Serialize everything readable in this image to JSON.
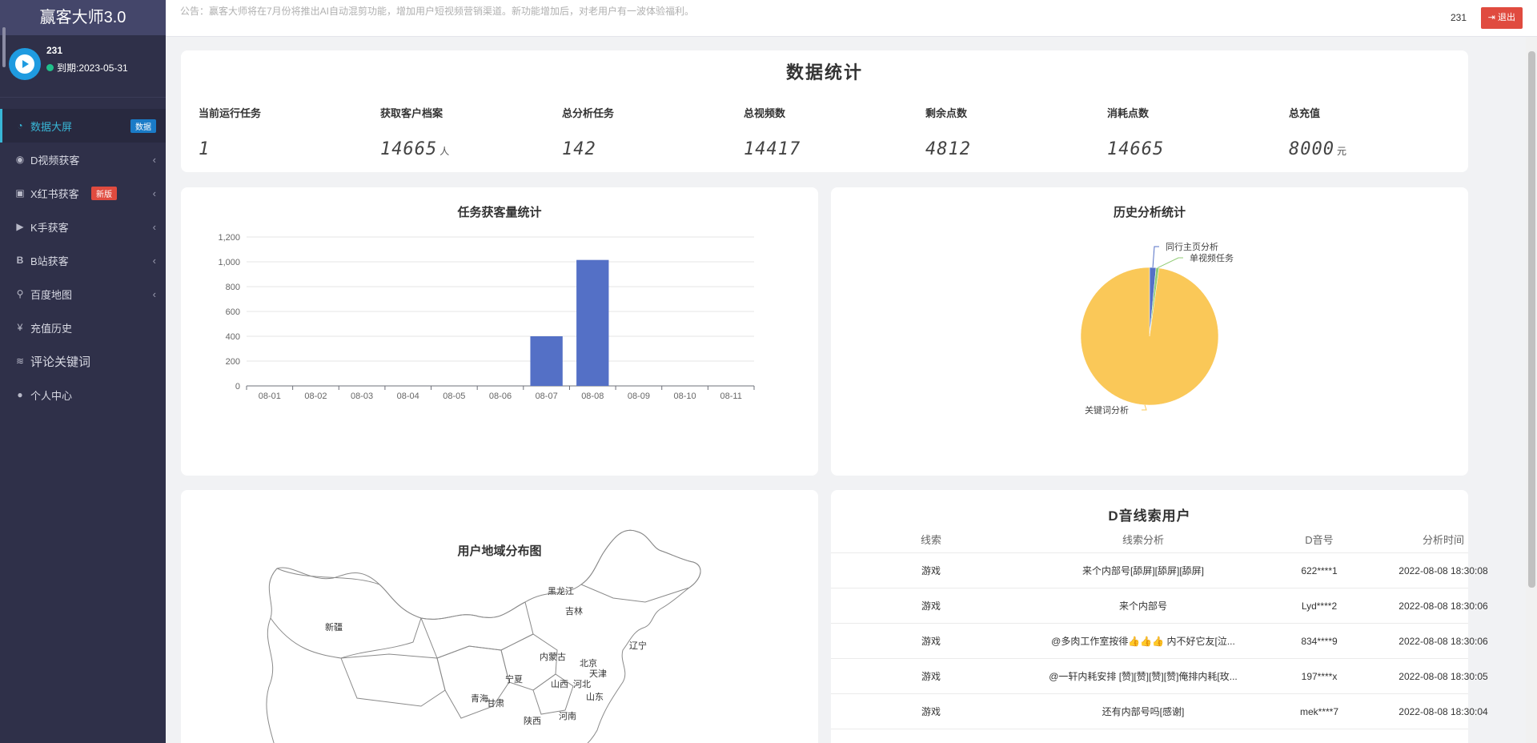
{
  "brand": "赢客大师3.0",
  "user": {
    "name": "231",
    "expire": "到期:2023-05-31"
  },
  "menu": [
    {
      "label": "数据大屏",
      "icon": "dashboard-icon",
      "tag": "数据"
    },
    {
      "label": "D视频获客",
      "icon": "eye-icon"
    },
    {
      "label": "X红书获客",
      "icon": "book-icon",
      "tag": "新版"
    },
    {
      "label": "K手获客",
      "icon": "play-circle-icon"
    },
    {
      "label": "B站获客",
      "icon": "bold-b-icon"
    },
    {
      "label": "百度地图",
      "icon": "map-pin-icon"
    },
    {
      "label": "充值历史",
      "icon": "yen-icon"
    },
    {
      "label": "评论关键词",
      "icon": "rss-icon"
    },
    {
      "label": "个人中心",
      "icon": "user-icon"
    }
  ],
  "topbar": {
    "notice": "公告：赢客大师将在7月份将推出AI自动混剪功能，增加用户短视频营销渠道。新功能增加后，对老用户有一波体验福利。",
    "username": "231",
    "logout": "退出"
  },
  "stats": {
    "title": "数据统计",
    "items": [
      {
        "label": "当前运行任务",
        "value": "1",
        "unit": ""
      },
      {
        "label": "获取客户档案",
        "value": "14665",
        "unit": "人"
      },
      {
        "label": "总分析任务",
        "value": "142",
        "unit": ""
      },
      {
        "label": "总视频数",
        "value": "14417",
        "unit": ""
      },
      {
        "label": "剩余点数",
        "value": "4812",
        "unit": ""
      },
      {
        "label": "消耗点数",
        "value": "14665",
        "unit": ""
      },
      {
        "label": "总充值",
        "value": "8000",
        "unit": "元"
      }
    ]
  },
  "bar_chart": {
    "title": "任务获客量统计"
  },
  "pie_chart": {
    "title": "历史分析统计"
  },
  "chart_data": [
    {
      "type": "bar",
      "title": "任务获客量统计",
      "categories": [
        "08-01",
        "08-02",
        "08-03",
        "08-04",
        "08-05",
        "08-06",
        "08-07",
        "08-08",
        "08-09",
        "08-10",
        "08-11"
      ],
      "values": [
        0,
        0,
        0,
        0,
        0,
        0,
        400,
        1015,
        0,
        0,
        0
      ],
      "ylim": [
        0,
        1200
      ],
      "yticks": [
        "0",
        "200",
        "400",
        "600",
        "800",
        "1,000",
        "1,200"
      ],
      "color": "#5470c6",
      "grid": true
    },
    {
      "type": "pie",
      "title": "历史分析统计",
      "slices": [
        {
          "name": "同行主页分析",
          "value": 1.5,
          "color": "#5470c6"
        },
        {
          "name": "单视频任务",
          "value": 0.7,
          "color": "#91cc75"
        },
        {
          "name": "关键词分析",
          "value": 97.8,
          "color": "#fac858"
        }
      ]
    }
  ],
  "map": {
    "title": "用户地域分布图",
    "labels": [
      "黑龙江",
      "吉林",
      "新疆",
      "辽宁",
      "内蒙古",
      "北京",
      "天津",
      "宁夏",
      "山西",
      "河北",
      "青海",
      "甘肃",
      "山东",
      "陕西",
      "河南"
    ]
  },
  "table": {
    "title": "D音线索用户",
    "headers": [
      "线索",
      "线索分析",
      "D音号",
      "分析时间"
    ],
    "rows": [
      [
        "游戏",
        "来个内部号[舔屏][舔屏][舔屏]",
        "622****1",
        "2022-08-08 18:30:08"
      ],
      [
        "游戏",
        "来个内部号",
        "Lyd****2",
        "2022-08-08 18:30:06"
      ],
      [
        "游戏",
        "@多肉工作室按徘👍👍👍 内不好它友[泣...",
        "834****9",
        "2022-08-08 18:30:06"
      ],
      [
        "游戏",
        "@一轩内耗安排 [赞][赞][赞][赞]俺排内耗[玫...",
        "197****x",
        "2022-08-08 18:30:05"
      ],
      [
        "游戏",
        "还有内部号吗[感谢]",
        "mek****7",
        "2022-08-08 18:30:04"
      ]
    ]
  }
}
